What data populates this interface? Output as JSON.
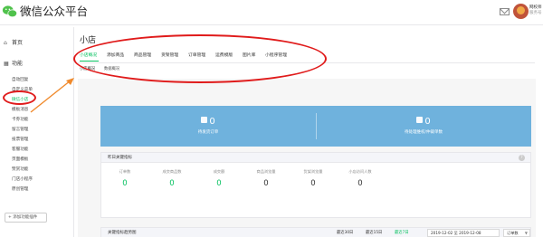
{
  "header": {
    "brand_title": "微信公众平台",
    "logo_icon": "wechat-logo",
    "mail_icon": "mail-icon",
    "account_name": "网校师",
    "account_sub": "服务号",
    "accent_color": "#07c160"
  },
  "sidebar": {
    "home_label": "首页",
    "features_label": "功能",
    "items": [
      {
        "label": "自动回复",
        "active": false
      },
      {
        "label": "自定义菜单",
        "active": false
      },
      {
        "label": "微信小店",
        "active": true
      },
      {
        "label": "模板消息",
        "active": false
      },
      {
        "label": "卡券功能",
        "active": false
      },
      {
        "label": "留言管理",
        "active": false
      },
      {
        "label": "投票管理",
        "active": false
      },
      {
        "label": "客服功能",
        "active": false
      },
      {
        "label": "页面模板",
        "active": false
      },
      {
        "label": "赞赏功能",
        "active": false
      },
      {
        "label": "门店小程序",
        "active": false
      },
      {
        "label": "原创管理",
        "active": false
      }
    ],
    "add_plugin_label": "+ 添加功能插件"
  },
  "main": {
    "page_title": "小店",
    "tabs": [
      {
        "label": "小店概况",
        "active": true
      },
      {
        "label": "添加商品",
        "active": false
      },
      {
        "label": "商品管理",
        "active": false
      },
      {
        "label": "货架管理",
        "active": false
      },
      {
        "label": "订单管理",
        "active": false
      },
      {
        "label": "运费模版",
        "active": false
      },
      {
        "label": "图片库",
        "active": false
      },
      {
        "label": "小程序管理",
        "active": false
      }
    ],
    "subtabs": [
      {
        "label": "小店概况",
        "active": true
      },
      {
        "label": "数据概况",
        "active": false
      }
    ],
    "stats": [
      {
        "value": "0",
        "label": "待发货订单",
        "icon": "shopping-bag-icon"
      },
      {
        "value": "0",
        "label": "待处理维权/仲裁单数",
        "icon": "shopping-bag-icon"
      }
    ],
    "kpi": {
      "title": "昨日关键指标",
      "items": [
        {
          "label": "订单数",
          "value": "0"
        },
        {
          "label": "成交商品数",
          "value": "0"
        },
        {
          "label": "成交额",
          "value": "0"
        },
        {
          "label": "商品浏览量",
          "value": "0"
        },
        {
          "label": "货架浏览量",
          "value": "0"
        },
        {
          "label": "小店访问人数",
          "value": "0"
        }
      ]
    },
    "trend": {
      "title": "关键指标趋势图",
      "ranges": [
        {
          "label": "最近30日",
          "active": false
        },
        {
          "label": "最近15日",
          "active": false
        },
        {
          "label": "最近7日",
          "active": true
        }
      ],
      "date_range": "2019-12-02 至 2019-12-08",
      "metric_selected": "订单数"
    }
  }
}
